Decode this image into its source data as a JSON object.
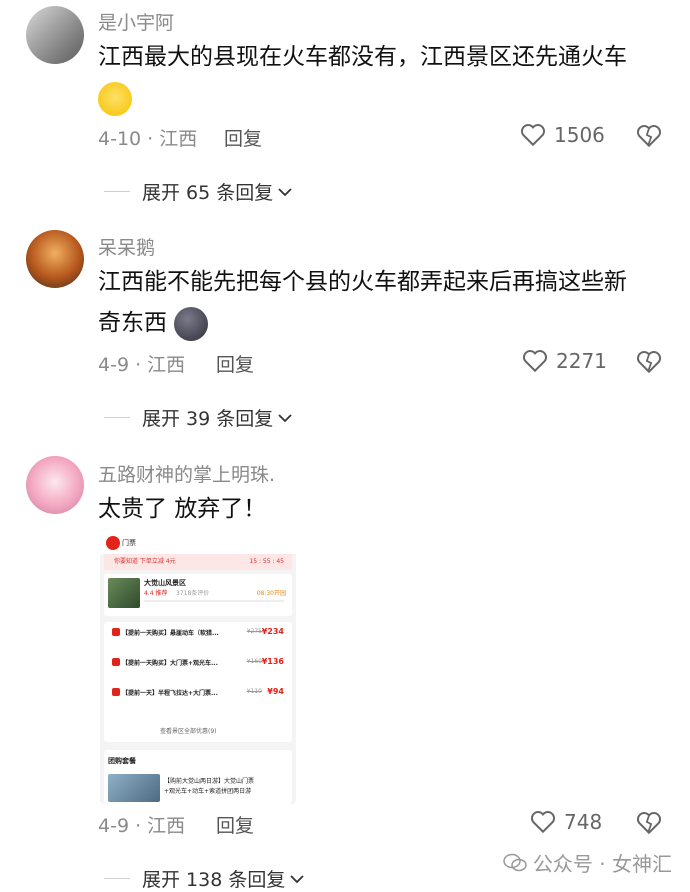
{
  "comments": [
    {
      "username": "是小宇阿",
      "text": "江西最大的县现在火车都没有，江西景区还先通火车",
      "date_loc": "4-10 · 江西",
      "reply_label": "回复",
      "likes": "1506",
      "expand": "展开 65 条回复"
    },
    {
      "username": "呆呆鹅",
      "text_line1": "江西能不能先把每个县的火车都弄起来后再搞这些新",
      "text_line2": "奇东西",
      "date_loc": "4-9 · 江西",
      "reply_label": "回复",
      "likes": "2271",
      "expand": "展开 39 条回复"
    },
    {
      "username": "五路财神的掌上明珠.",
      "text": "太贵了 放弃了！",
      "date_loc": "4-9 · 江西",
      "reply_label": "回复",
      "likes": "748",
      "expand": "展开 138 条回复"
    }
  ],
  "screenshot": {
    "header": "门票",
    "notice": "你要知道   下单立减 4元",
    "countdown": "15 : 55 : 45",
    "scenic_name": "大觉山风景区",
    "rating": "4.4 推荐",
    "reviews": "3718条评价",
    "open_time": "08:30开园",
    "items": [
      {
        "title": "【提前一天购买】悬崖动车（软猎...",
        "price": "¥234",
        "old": "¥275"
      },
      {
        "title": "【提前一天购买】大门票+观光车...",
        "price": "¥136",
        "old": "¥160"
      },
      {
        "title": "【提前一天】半程飞拉达+大门票...",
        "price": "¥94",
        "old": "¥110"
      }
    ],
    "see_all": "查看景区全部优惠(9)",
    "group_title": "团购套餐",
    "group_item_line1": "【购前大觉山两日游】大觉山门票",
    "group_item_line2": "+观光车+动车+索道拼团两日游"
  },
  "watermark": "公众号 · 女神汇"
}
